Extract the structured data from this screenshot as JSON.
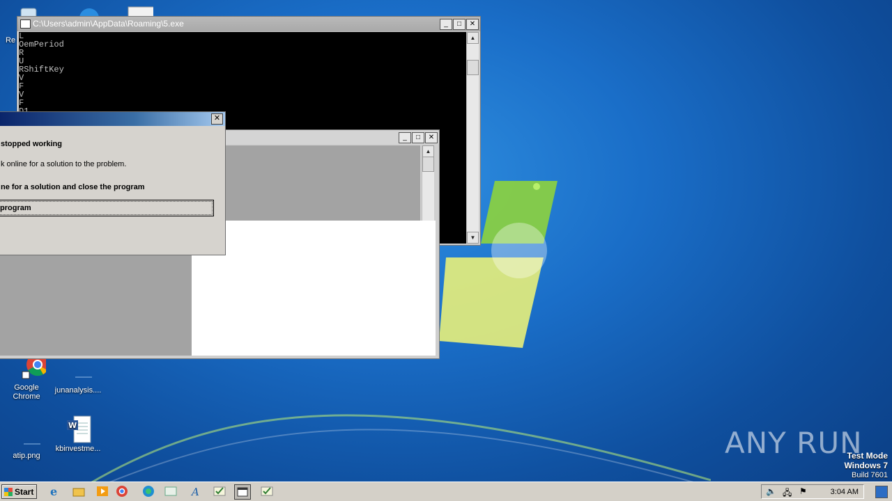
{
  "desktop": {
    "icons": [
      {
        "name": "recycle-bin",
        "label": "Re",
        "icon": "recycle-bin-icon"
      },
      {
        "name": "google-chrome",
        "label": "Google Chrome",
        "icon": "chrome-icon"
      },
      {
        "name": "junanalysis",
        "label": "junanalysis....",
        "icon": "file-icon"
      },
      {
        "name": "atip",
        "label": "atip.png",
        "icon": "image-file-icon"
      },
      {
        "name": "kbinvestme",
        "label": "kbinvestme...",
        "icon": "word-doc-icon"
      }
    ]
  },
  "console": {
    "title": "C:\\Users\\admin\\AppData\\Roaming\\5.exe",
    "lines": [
      "L",
      "OemPeriod",
      "R",
      "U",
      "RShiftKey",
      "V",
      "F",
      "V",
      "F",
      "D1"
    ]
  },
  "error_dialog": {
    "line1": "stopped working",
    "line2": "k online for a solution to the problem.",
    "line3": "ne for a solution and close the program",
    "button": "program"
  },
  "watermark": {
    "brand": "ANY RUN",
    "test_mode": "Test Mode",
    "os": "Windows 7",
    "build": "Build 7601"
  },
  "taskbar": {
    "start_label": "Start",
    "items": [
      "ie-icon",
      "explorer-icon",
      "media-player-icon",
      "chrome-icon",
      "edge-icon",
      "app-icon",
      "font-icon",
      "checkmark-app-icon",
      "console-app-icon",
      "checkmark-app-icon"
    ],
    "clock": "3:04 AM"
  },
  "colors": {
    "desktop_bg": "#1a6ec8",
    "dialog_title": "#0a246a",
    "console_bg": "#000000"
  }
}
